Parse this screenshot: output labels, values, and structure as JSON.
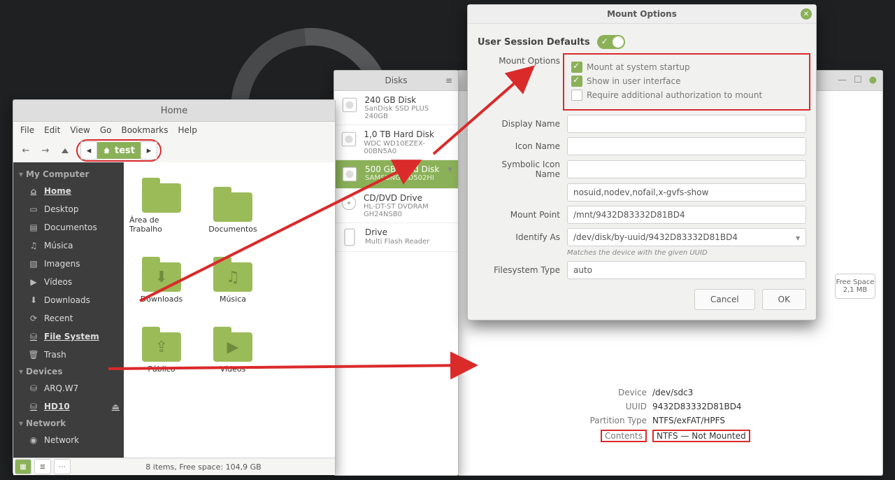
{
  "file_manager": {
    "title": "Home",
    "menu": [
      "File",
      "Edit",
      "View",
      "Go",
      "Bookmarks",
      "Help"
    ],
    "path_seg": "test",
    "sidebar": {
      "my_computer": "My Computer",
      "items": [
        "Home",
        "Desktop",
        "Documentos",
        "Música",
        "Imagens",
        "Vídeos",
        "Downloads",
        "Recent",
        "File System",
        "Trash"
      ],
      "devices": "Devices",
      "dev_items": [
        "ARQ.W7",
        "HD10"
      ],
      "network": "Network",
      "net_items": [
        "Network"
      ]
    },
    "folders": [
      "Área de Trabalho",
      "Documentos",
      "Downloads",
      "Música",
      "Público",
      "Vídeos"
    ],
    "status": "8 items, Free space: 104,9 GB"
  },
  "disks": {
    "title": "Disks",
    "items": [
      {
        "title": "240 GB Disk",
        "sub": "SanDisk SSD PLUS 240GB"
      },
      {
        "title": "1,0 TB Hard Disk",
        "sub": "WDC WD10EZEX-00BN5A0"
      },
      {
        "title": "500 GB Hard Disk",
        "sub": "SAMSUNG HD502HI",
        "sel": true
      },
      {
        "title": "CD/DVD Drive",
        "sub": "HL-DT-ST DVDRAM GH24NSB0"
      },
      {
        "title": "Drive",
        "sub": "Multi Flash Reader"
      }
    ]
  },
  "mount": {
    "title": "Mount Options",
    "usd_label": "User Session Defaults",
    "mo_label": "Mount Options",
    "opts": {
      "startup": "Mount at system startup",
      "show": "Show in user interface",
      "auth": "Require additional authorization to mount"
    },
    "display_name": "Display Name",
    "icon_name": "Icon Name",
    "sym_name": "Symbolic Icon Name",
    "flags": "nosuid,nodev,nofail,x-gvfs-show",
    "mount_point_label": "Mount Point",
    "mount_point": "/mnt/9432D83332D81BD4",
    "identify_label": "Identify As",
    "identify": "/dev/disk/by-uuid/9432D83332D81BD4",
    "hint": "Matches the device with the given UUID",
    "fs_label": "Filesystem Type",
    "fs": "auto",
    "cancel": "Cancel",
    "ok": "OK"
  },
  "diskinfo": {
    "free_label": "Free Space",
    "free": "2,1 MB",
    "device_l": "Device",
    "device": "/dev/sdc3",
    "uuid_l": "UUID",
    "uuid": "9432D83332D81BD4",
    "pt_l": "Partition Type",
    "pt": "NTFS/exFAT/HPFS",
    "contents_l": "Contents",
    "contents": "NTFS — Not Mounted"
  }
}
